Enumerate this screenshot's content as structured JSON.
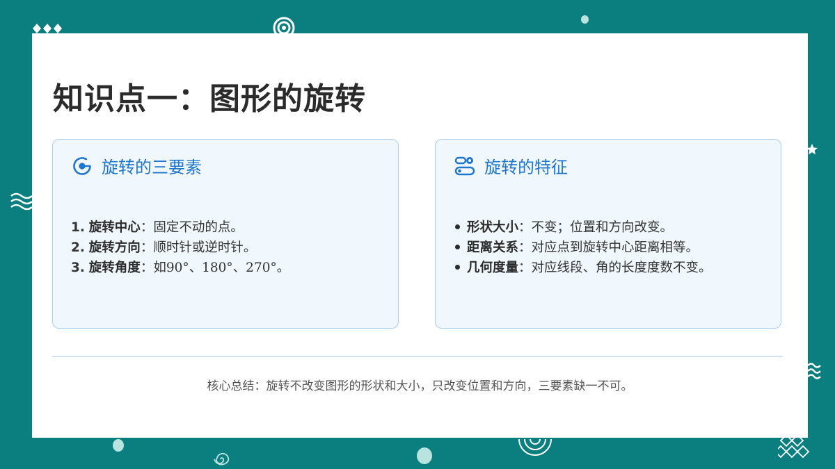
{
  "slide": {
    "title": "知识点一：图形的旋转"
  },
  "left_panel": {
    "icon": "target-dot-icon",
    "title": "旋转的三要素",
    "items": [
      {
        "num": "1.",
        "term": "旋转中心",
        "sep": "：",
        "desc": "固定不动的点。"
      },
      {
        "num": "2.",
        "term": "旋转方向",
        "sep": "：",
        "desc": "顺时针或逆时针。"
      },
      {
        "num": "3.",
        "term": "旋转角度",
        "sep": "：",
        "desc": "如90°、180°、270°。"
      }
    ]
  },
  "right_panel": {
    "icon": "toggle-settings-icon",
    "title": "旋转的特征",
    "items": [
      {
        "term": "形状大小",
        "sep": "：",
        "desc": "不变；位置和方向改变。"
      },
      {
        "term": "距离关系",
        "sep": "：",
        "desc": "对应点到旋转中心距离相等。"
      },
      {
        "term": "几何度量",
        "sep": "：",
        "desc": "对应线段、角的长度度数不变。"
      }
    ]
  },
  "summary": "核心总结：旋转不改变图形的形状和大小，只改变位置和方向，三要素缺一不可。",
  "colors": {
    "background": "#0b7f80",
    "accent_blue": "#1f76cf",
    "panel_fill": "#f0f8fd",
    "panel_border": "#a9d0ef"
  }
}
